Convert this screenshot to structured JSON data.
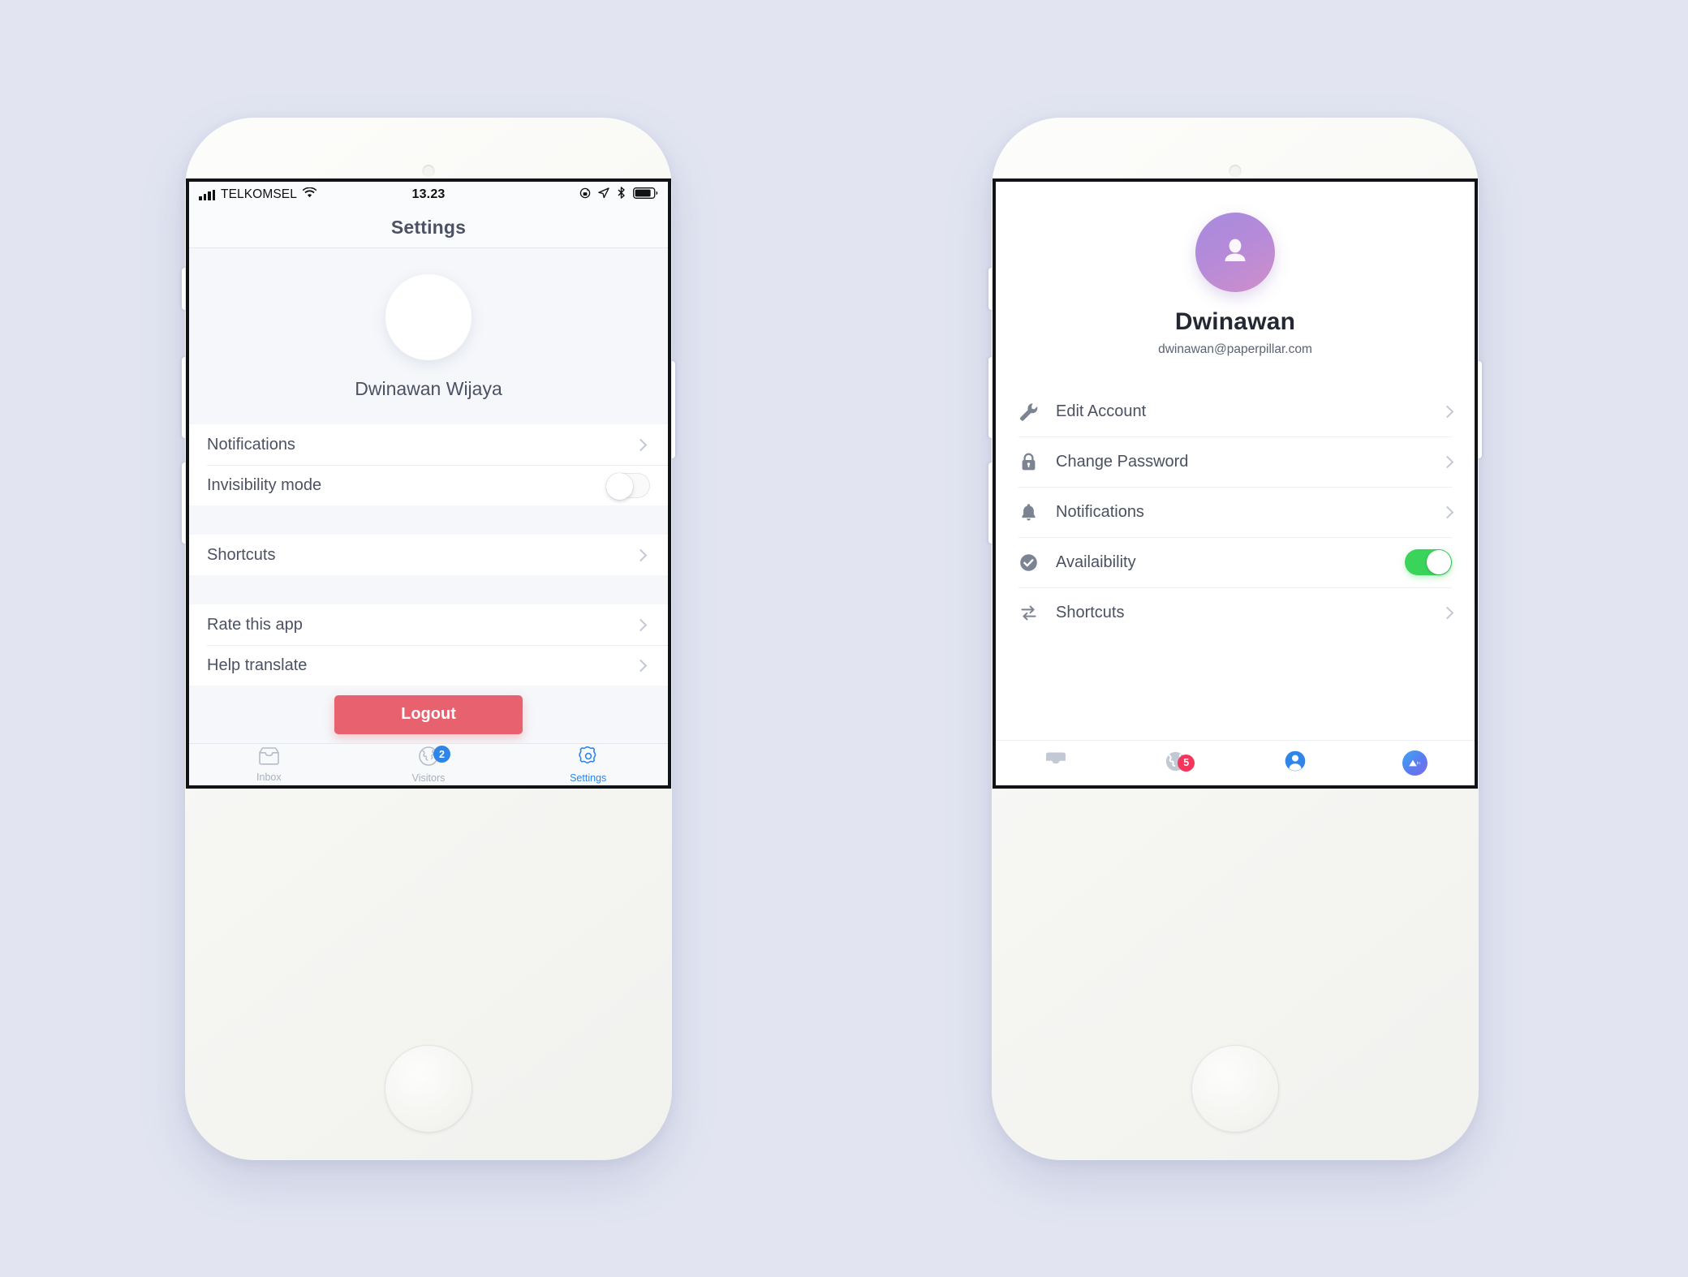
{
  "left_phone": {
    "status_bar": {
      "carrier": "TELKOMSEL",
      "time": "13.23",
      "signal_icon": "signal-bars-icon",
      "wifi_icon": "wifi-icon",
      "rotation_lock_icon": "rotation-lock-icon",
      "location_icon": "location-arrow-icon",
      "bluetooth_icon": "bluetooth-icon",
      "battery_icon": "battery-icon"
    },
    "nav_title": "Settings",
    "profile": {
      "name": "Dwinawan Wijaya",
      "avatar": "avatar-placeholder"
    },
    "groups": [
      {
        "rows": [
          {
            "label": "Notifications",
            "control": "chevron"
          },
          {
            "label": "Invisibility mode",
            "control": "toggle",
            "toggle_on": false
          }
        ]
      },
      {
        "rows": [
          {
            "label": "Shortcuts",
            "control": "chevron"
          }
        ]
      },
      {
        "rows": [
          {
            "label": "Rate this app",
            "control": "chevron"
          },
          {
            "label": "Help translate",
            "control": "chevron"
          }
        ]
      }
    ],
    "logout_label": "Logout",
    "logout_color": "#e8616e",
    "tabs": [
      {
        "label": "Inbox",
        "icon": "inbox-tray-icon",
        "active": false,
        "badge": null
      },
      {
        "label": "Visitors",
        "icon": "globe-icon",
        "active": false,
        "badge": "2"
      },
      {
        "label": "Settings",
        "icon": "gear-icon",
        "active": true,
        "badge": null
      }
    ],
    "accent_color": "#2f86e8"
  },
  "right_phone": {
    "profile": {
      "name": "Dwinawan",
      "email": "dwinawan@paperpillar.com",
      "avatar_icon": "person-avatar-icon",
      "avatar_gradient_from": "#a78bde",
      "avatar_gradient_to": "#cf8fc9"
    },
    "rows": [
      {
        "label": "Edit Account",
        "icon": "wrench-icon",
        "control": "chevron"
      },
      {
        "label": "Change Password",
        "icon": "lock-icon",
        "control": "chevron"
      },
      {
        "label": "Notifications",
        "icon": "bell-icon",
        "control": "chevron"
      },
      {
        "label": "Availaibility",
        "icon": "check-circle-icon",
        "control": "toggle",
        "toggle_on": true
      },
      {
        "label": "Shortcuts",
        "icon": "swap-arrows-icon",
        "control": "chevron"
      }
    ],
    "toggle_on_color": "#3ad45a",
    "tabs": [
      {
        "icon": "inbox-tray-icon",
        "active": false,
        "badge": null
      },
      {
        "icon": "globe-icon",
        "active": false,
        "badge": "5"
      },
      {
        "icon": "person-icon",
        "active": true,
        "badge": null
      },
      {
        "icon": "app-logo-icon",
        "active": false,
        "badge": null
      }
    ],
    "badge_color": "#f4365c",
    "active_tab_color": "#2f86e8"
  },
  "background_color": "#e2e5f1"
}
